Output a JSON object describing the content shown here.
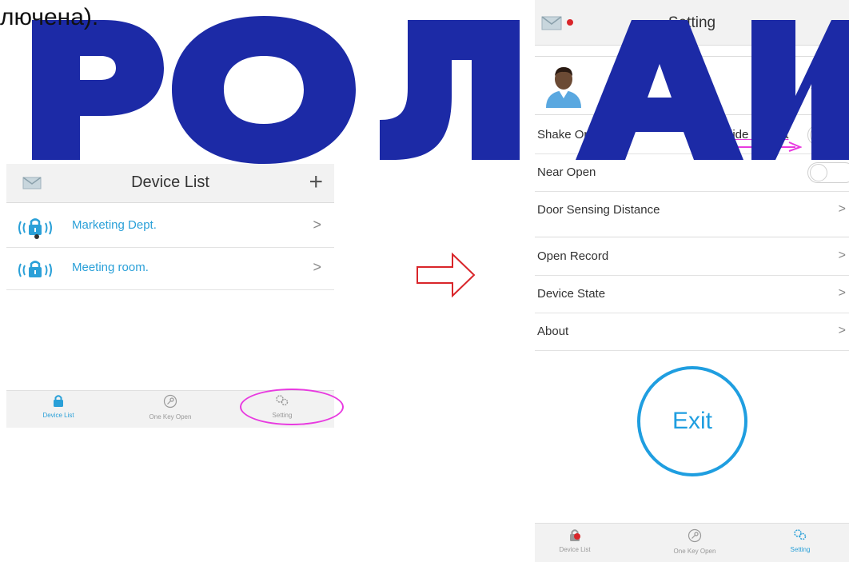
{
  "intro_text": "лючена).",
  "watermark": "РОЛАИ",
  "colors": {
    "accent": "#1f9ee0",
    "highlight": "#e83ae0",
    "alert": "#d9252a",
    "watermark": "#1c2aa6",
    "arrow": "#d9252a"
  },
  "left_screen": {
    "header": {
      "title": "Device List",
      "add_icon": "+",
      "mail_icon": "mail-icon"
    },
    "devices": [
      {
        "name": "Marketing Dept.",
        "chevron": ">"
      },
      {
        "name": "Meeting room.",
        "chevron": ">"
      }
    ],
    "tabs": [
      {
        "label": "Device List",
        "icon": "lock-icon",
        "active": true
      },
      {
        "label": "One Key Open",
        "icon": "key-icon",
        "active": false
      },
      {
        "label": "Setting",
        "icon": "gears-icon",
        "active": false
      }
    ]
  },
  "right_screen": {
    "header": {
      "title": "Setting",
      "mail_icon": "mail-icon"
    },
    "user": {
      "label": "User",
      "chevron": ">"
    },
    "annotation": "Slide to right",
    "toggles": [
      {
        "label": "Shake Open",
        "on": false
      },
      {
        "label": "Near Open",
        "on": false
      }
    ],
    "menu": [
      {
        "label": "Door Sensing Distance",
        "chevron": ">"
      },
      {
        "label": "Open Record",
        "chevron": ">"
      },
      {
        "label": "Device State",
        "chevron": ">"
      },
      {
        "label": "About",
        "chevron": ">"
      }
    ],
    "exit_label": "Exit",
    "tabs": [
      {
        "label": "Device List",
        "icon": "lock-icon",
        "active": false
      },
      {
        "label": "One Key Open",
        "icon": "key-icon",
        "active": false
      },
      {
        "label": "Setting",
        "icon": "gears-icon",
        "active": true
      }
    ]
  }
}
